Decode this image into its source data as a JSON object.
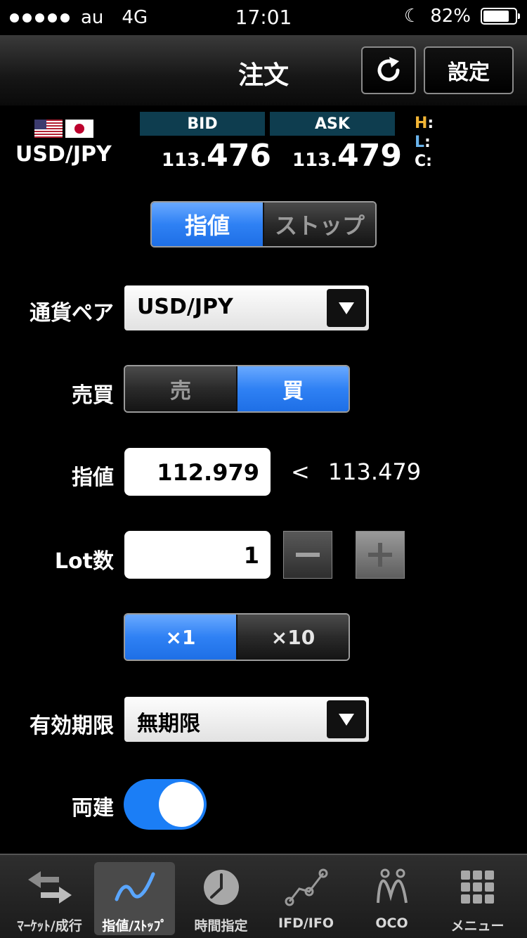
{
  "status_bar": {
    "carrier": "au",
    "network": "4G",
    "time": "17:01",
    "battery_percent": "82%",
    "battery_level": 0.82
  },
  "nav": {
    "title": "注文",
    "settings_label": "設定",
    "refresh_icon": "refresh-icon"
  },
  "quote": {
    "pair": "USD/JPY",
    "bid_label": "BID",
    "ask_label": "ASK",
    "bid_small": "113.",
    "bid_big": "476",
    "ask_small": "113.",
    "ask_big": "479",
    "h_label": "H",
    "l_label": "L",
    "c_label": "C",
    "colon": ":",
    "colors": {
      "header_bg": "#0e3d4f",
      "high": "#f2b535",
      "low": "#6ab4ec"
    }
  },
  "order_type": {
    "options": [
      "指値",
      "ストップ"
    ],
    "selected": "指値"
  },
  "form": {
    "pair_label": "通貨ペア",
    "pair_value": "USD/JPY",
    "side_label": "売買",
    "side_options": [
      "売",
      "買"
    ],
    "side_selected": "買",
    "price_label": "指値",
    "price_value": "112.979",
    "compare_symbol": "<",
    "compare_value": "113.479",
    "lot_label": "Lot数",
    "lot_value": "1",
    "multiplier_options": [
      "×1",
      "×10"
    ],
    "multiplier_selected": "×1",
    "expiry_label": "有効期限",
    "expiry_value": "無期限",
    "hedge_label": "両建",
    "hedge_on": true
  },
  "tabs": [
    {
      "label": "ﾏｰｹｯﾄ/成行",
      "icon": "swap-arrows-icon",
      "active": false
    },
    {
      "label": "指値/ｽﾄｯﾌﾟ",
      "icon": "line-chart-icon",
      "active": true
    },
    {
      "label": "時間指定",
      "icon": "clock-icon",
      "active": false
    },
    {
      "label": "IFD/IFO",
      "icon": "ifd-chart-icon",
      "active": false
    },
    {
      "label": "OCO",
      "icon": "oco-chart-icon",
      "active": false
    },
    {
      "label": "メニュー",
      "icon": "grid-menu-icon",
      "active": false
    }
  ],
  "accent_color": "#1b7ef6"
}
